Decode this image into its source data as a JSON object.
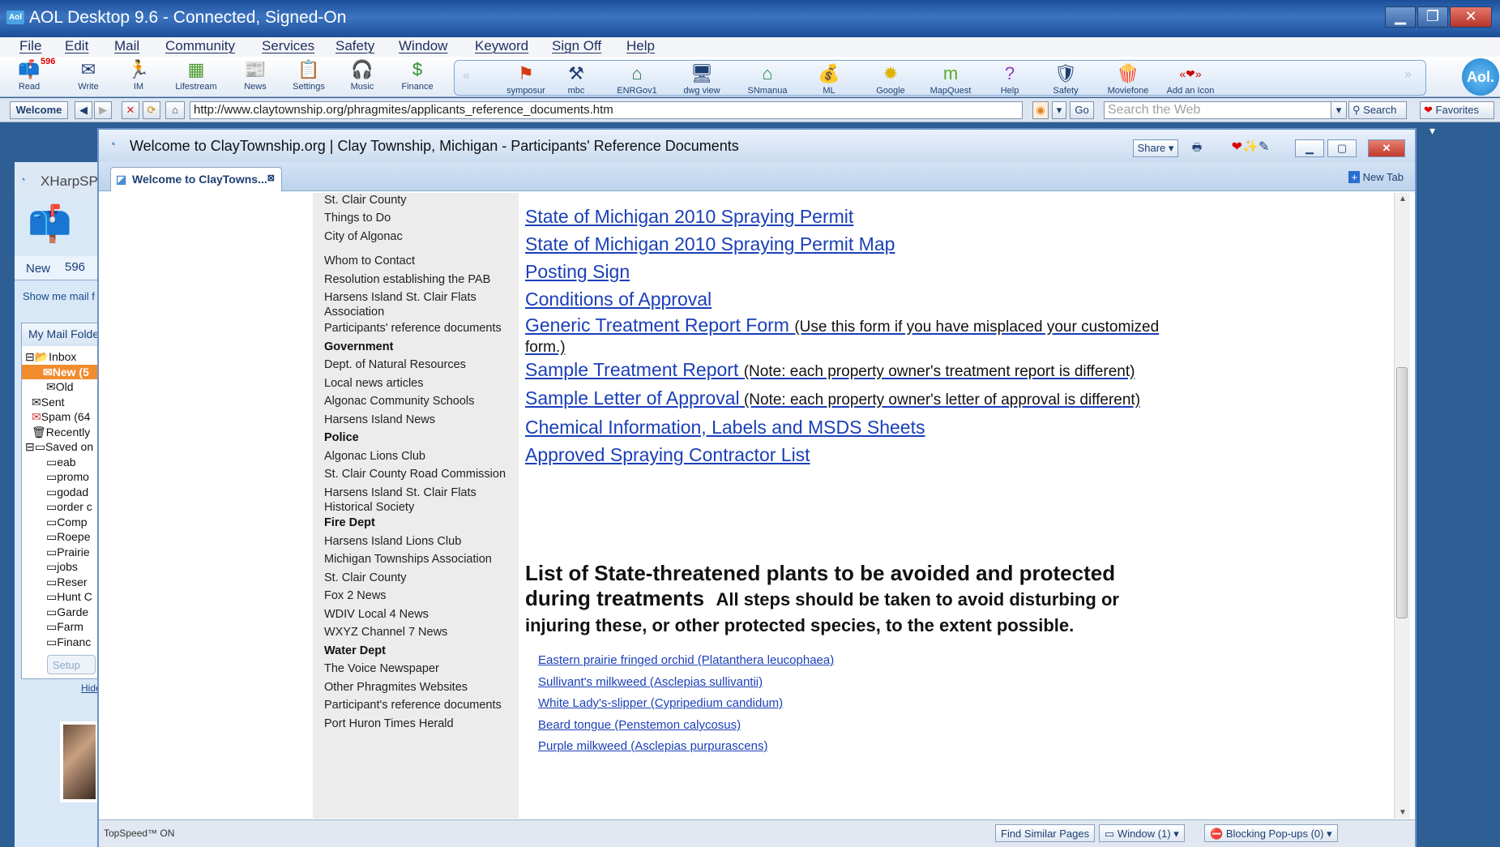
{
  "app": {
    "title": "AOL Desktop 9.6 - Connected, Signed-On",
    "icon_label": "Aol."
  },
  "menu": [
    "File",
    "Edit",
    "Mail",
    "Community",
    "Services",
    "Safety",
    "Window",
    "Keyword",
    "Sign Off",
    "Help"
  ],
  "toolbar": {
    "read_badge": "596",
    "main_buttons": [
      {
        "label": "Read",
        "icon": "mailbox-icon"
      },
      {
        "label": "Write",
        "icon": "pencil-envelope-icon"
      },
      {
        "label": "IM",
        "icon": "running-man-icon"
      },
      {
        "label": "Lifestream",
        "icon": "lifestream-icon"
      },
      {
        "label": "News",
        "icon": "newspaper-icon"
      },
      {
        "label": "Settings",
        "icon": "settings-icon"
      },
      {
        "label": "Music",
        "icon": "headphones-icon"
      },
      {
        "label": "Finance",
        "icon": "money-icon"
      }
    ],
    "favorites": [
      {
        "label": "symposur",
        "icon": "flag-icon"
      },
      {
        "label": "mbc",
        "icon": "hammer-icon"
      },
      {
        "label": "ENRGov1",
        "icon": "house-icon"
      },
      {
        "label": "dwg view",
        "icon": "monitor-icon"
      },
      {
        "label": "SNmanua",
        "icon": "house-icon"
      },
      {
        "label": "ML",
        "icon": "money-bag-icon"
      },
      {
        "label": "Google",
        "icon": "sun-icon"
      },
      {
        "label": "MapQuest",
        "icon": "mapquest-icon"
      },
      {
        "label": "Help",
        "icon": "question-icon"
      },
      {
        "label": "Safety",
        "icon": "shield-icon"
      },
      {
        "label": "Moviefone",
        "icon": "popcorn-icon"
      },
      {
        "label": "Add an Icon",
        "icon": "add-icon"
      }
    ]
  },
  "address": {
    "welcome": "Welcome",
    "url": "http://www.claytownship.org/phragmites/applicants_reference_documents.htm",
    "go": "Go",
    "search_placeholder": "Search the Web",
    "search_button": "Search",
    "favorites": "Favorites"
  },
  "mailpanel": {
    "title": "XHarpSP",
    "new_tab": "New",
    "new_count": "596",
    "show_me": "Show me mail f",
    "folders_header": "My Mail Folde",
    "folders": [
      "Inbox",
      "New (5",
      "Old",
      "Sent",
      "Spam (64",
      "Recently",
      "Saved on",
      "eab",
      "promo",
      "godad",
      "order c",
      "Comp",
      "Roepe",
      "Prairie",
      "jobs",
      "Reser",
      "Hunt C",
      "Garde",
      "Farm",
      "Financ"
    ],
    "setup": "Setup",
    "hide": "Hide"
  },
  "browser": {
    "title": "Welcome to ClayTownship.org | Clay Township, Michigan - Participants' Reference Documents",
    "tab": "Welcome to ClayTowns...",
    "share": "Share",
    "new_tab": "New Tab"
  },
  "leftnav": [
    {
      "label": "St. Clair County",
      "bold": false
    },
    {
      "label": "Things to Do",
      "bold": false
    },
    {
      "label": "City of Algonac",
      "bold": false
    },
    {
      "label": "Whom to Contact",
      "bold": false
    },
    {
      "label": "Resolution establishing the PAB",
      "bold": false
    },
    {
      "label": "Harsens Island St. Clair Flats Association",
      "bold": false
    },
    {
      "label": "Participants' reference documents",
      "bold": false
    },
    {
      "label": "Government",
      "bold": true
    },
    {
      "label": "Dept. of Natural Resources",
      "bold": false
    },
    {
      "label": "Local news articles",
      "bold": false
    },
    {
      "label": "Algonac Community Schools",
      "bold": false
    },
    {
      "label": "Harsens Island News",
      "bold": false
    },
    {
      "label": "Police",
      "bold": true
    },
    {
      "label": "Algonac Lions Club",
      "bold": false
    },
    {
      "label": "St. Clair County Road Commission",
      "bold": false
    },
    {
      "label": "Harsens Island St. Clair Flats Historical Society",
      "bold": false
    },
    {
      "label": "Fire Dept",
      "bold": true
    },
    {
      "label": "Harsens Island Lions Club",
      "bold": false
    },
    {
      "label": "Michigan Townships Association",
      "bold": false
    },
    {
      "label": "St. Clair County",
      "bold": false
    },
    {
      "label": "Fox 2 News",
      "bold": false
    },
    {
      "label": "WDIV Local 4 News",
      "bold": false
    },
    {
      "label": "WXYZ Channel 7 News",
      "bold": false
    },
    {
      "label": "Water Dept",
      "bold": true
    },
    {
      "label": "The Voice Newspaper",
      "bold": false
    },
    {
      "label": "Other Phragmites Websites",
      "bold": false
    },
    {
      "label": "Participant's reference documents",
      "bold": false
    },
    {
      "label": "Port Huron Times Herald",
      "bold": false
    }
  ],
  "documents": [
    {
      "label": "State of Michigan 2010 Spraying Permit",
      "note": ""
    },
    {
      "label": "State of Michigan 2010 Spraying Permit Map",
      "note": ""
    },
    {
      "label": "Posting Sign",
      "note": ""
    },
    {
      "label": "Conditions of Approval",
      "note": ""
    },
    {
      "label": "Generic Treatment Report Form ",
      "note": "(Use this form if you have misplaced your customized form.)"
    },
    {
      "label": "Sample Treatment Report ",
      "note": "(Note: each property owner's treatment report is different)"
    },
    {
      "label": "Sample Letter of Approval",
      "note": " (Note: each property owner's letter of approval is different)"
    },
    {
      "label": "Chemical Information, Labels and MSDS Sheets",
      "note": ""
    },
    {
      "label": "Approved Spraying Contractor List",
      "note": ""
    }
  ],
  "heading": {
    "big": "List of State-threatened plants to be avoided and protected during treatments",
    "small": "All steps should be taken to avoid disturbing or injuring these, or other protected species, to the extent possible."
  },
  "plants": [
    "Eastern prairie fringed orchid (Platanthera leucophaea)",
    "Sullivant's milkweed (Asclepias sullivantii)",
    "White Lady's-slipper (Cypripedium candidum)",
    "Beard tongue (Penstemon calycosus)",
    "Purple milkweed (Asclepias purpurascens)"
  ],
  "status": {
    "topspeed": "TopSpeed™ ON",
    "find_similar": "Find Similar Pages",
    "window": "Window (1)",
    "popups": "Blocking Pop-ups (0)"
  }
}
